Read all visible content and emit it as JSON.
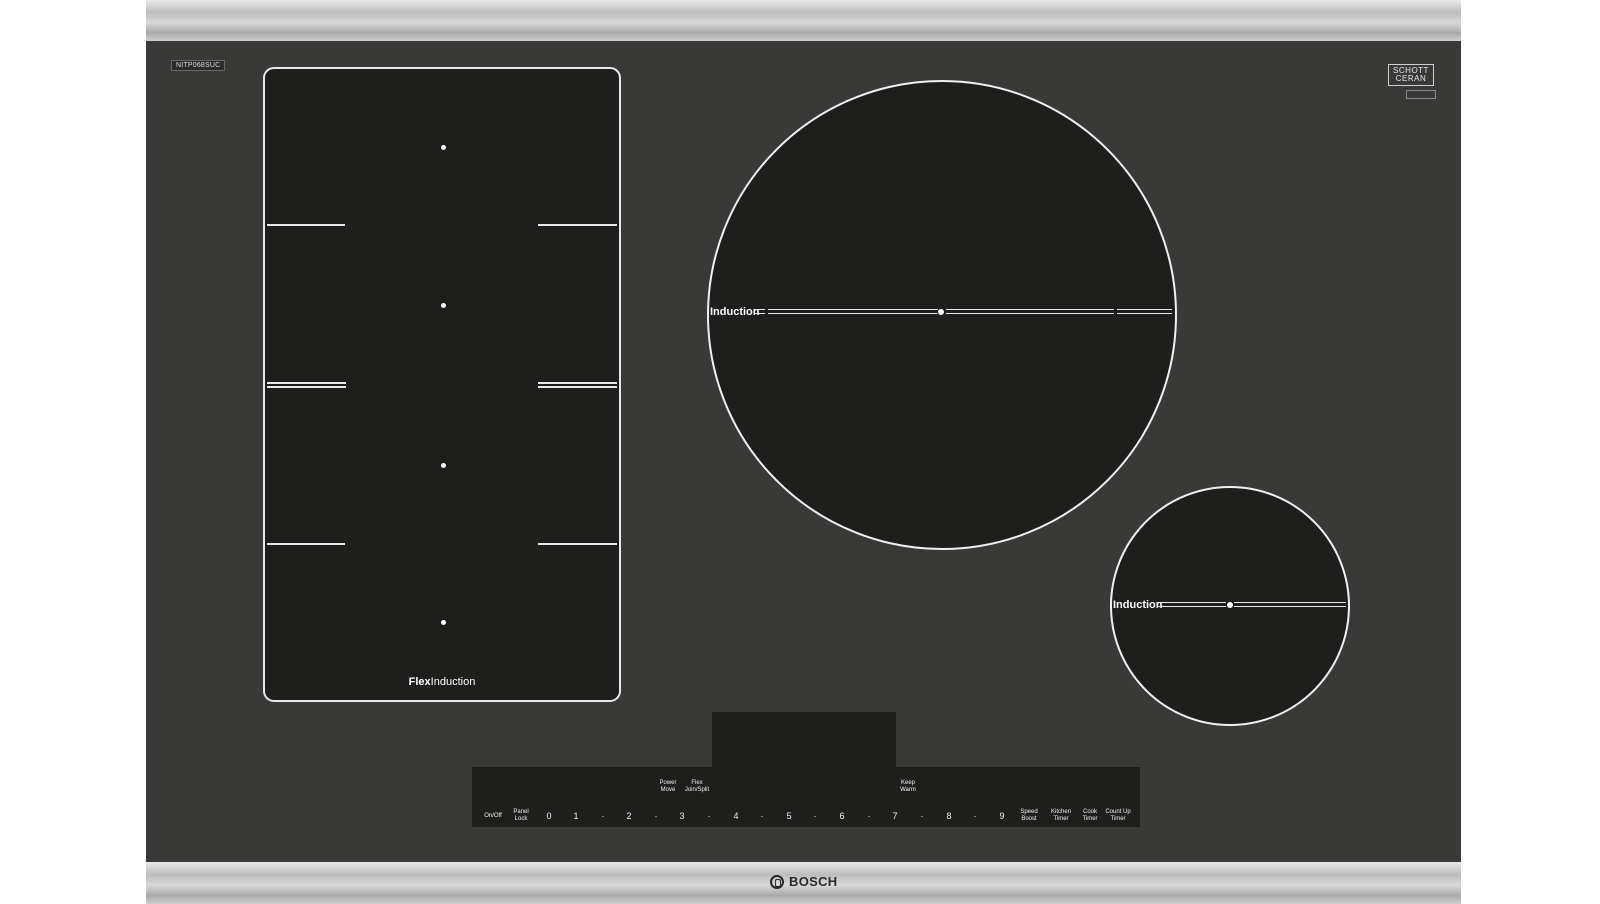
{
  "model_badge": "NITP068SUC",
  "schott_logo": "SCHOTT\nCERAN",
  "schott_sub": "",
  "zones": {
    "flex_label_bold": "Flex",
    "flex_label_regular": "Induction",
    "large_label": "Induction",
    "small_label": "Induction"
  },
  "controls": {
    "on_off": "On/Off",
    "panel_lock": "Panel\nLock",
    "power_move": "Power\nMove",
    "flex_join_split": "Flex\nJoin/Split",
    "keep_warm": "Keep\nWarm",
    "speed_boost": "Speed\nBoost",
    "kitchen_timer": "Kitchen\nTimer",
    "cook_timer": "Cook\nTimer",
    "count_up_timer": "Count Up\nTimer",
    "levels": [
      "0",
      "1",
      "·",
      "2",
      "·",
      "3",
      "·",
      "4",
      "·",
      "5",
      "·",
      "6",
      "·",
      "7",
      "·",
      "8",
      "·",
      "9"
    ]
  },
  "brand": "BOSCH",
  "colors": {
    "cooktop": "#393938",
    "zone": "#1e1e1d",
    "line": "#e8e8e8"
  }
}
